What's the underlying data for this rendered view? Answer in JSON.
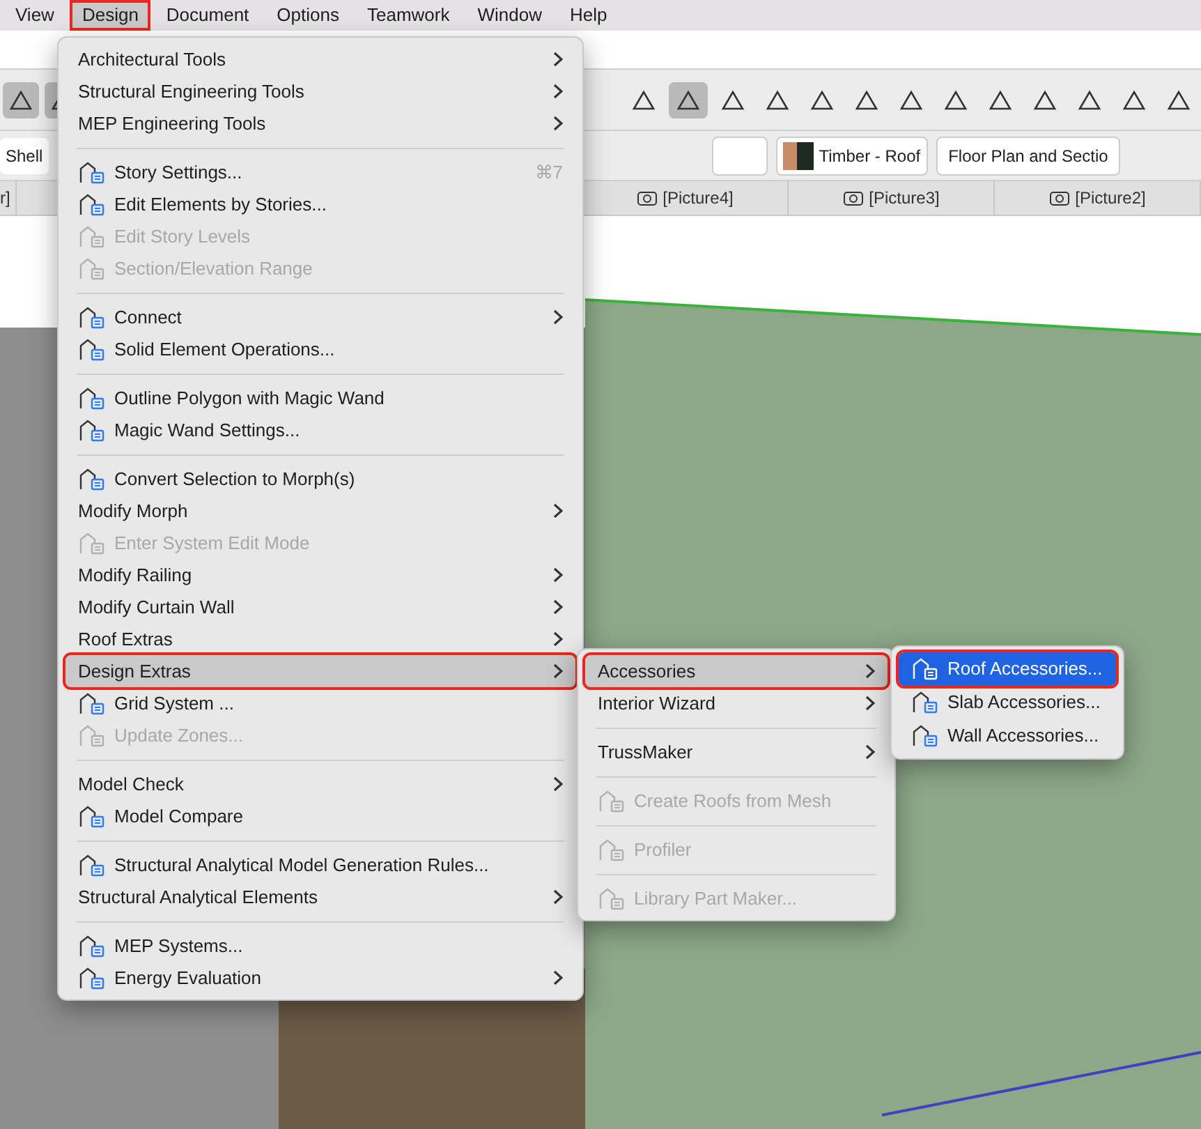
{
  "menu_bar": [
    {
      "label": "View",
      "selected": false,
      "annotated": false
    },
    {
      "label": "Design",
      "selected": true,
      "annotated": true
    },
    {
      "label": "Document",
      "selected": false,
      "annotated": false
    },
    {
      "label": "Options",
      "selected": false,
      "annotated": false
    },
    {
      "label": "Teamwork",
      "selected": false,
      "annotated": false
    },
    {
      "label": "Window",
      "selected": false,
      "annotated": false
    },
    {
      "label": "Help",
      "selected": false,
      "annotated": false
    }
  ],
  "toolbar": {
    "view_button": "Shell",
    "material": "Timber - Roof",
    "view_setting": "Floor Plan and Sectio"
  },
  "tabs": [
    {
      "label": "r]",
      "selected": false,
      "icon": false
    },
    {
      "label": "[Picture4]",
      "selected": false,
      "icon": true
    },
    {
      "label": "[Picture3]",
      "selected": false,
      "icon": true
    },
    {
      "label": "[Picture2]",
      "selected": false,
      "icon": true
    }
  ],
  "design_menu": [
    {
      "kind": "item",
      "label": "Architectural Tools",
      "icon": false,
      "submenu": true,
      "disabled": false,
      "selected": false,
      "annotated": false
    },
    {
      "kind": "item",
      "label": "Structural Engineering Tools",
      "icon": false,
      "submenu": true,
      "disabled": false,
      "selected": false,
      "annotated": false
    },
    {
      "kind": "item",
      "label": "MEP Engineering Tools",
      "icon": false,
      "submenu": true,
      "disabled": false,
      "selected": false,
      "annotated": false
    },
    {
      "kind": "separator"
    },
    {
      "kind": "item",
      "label": "Story Settings...",
      "icon": true,
      "submenu": false,
      "disabled": false,
      "selected": false,
      "annotated": false,
      "shortcut": "⌘7"
    },
    {
      "kind": "item",
      "label": "Edit Elements by Stories...",
      "icon": true,
      "submenu": false,
      "disabled": false,
      "selected": false,
      "annotated": false
    },
    {
      "kind": "item",
      "label": "Edit Story Levels",
      "icon": true,
      "submenu": false,
      "disabled": true,
      "selected": false,
      "annotated": false
    },
    {
      "kind": "item",
      "label": "Section/Elevation Range",
      "icon": true,
      "submenu": false,
      "disabled": true,
      "selected": false,
      "annotated": false
    },
    {
      "kind": "separator"
    },
    {
      "kind": "item",
      "label": "Connect",
      "icon": true,
      "submenu": true,
      "disabled": false,
      "selected": false,
      "annotated": false
    },
    {
      "kind": "item",
      "label": "Solid Element Operations...",
      "icon": true,
      "submenu": false,
      "disabled": false,
      "selected": false,
      "annotated": false
    },
    {
      "kind": "separator"
    },
    {
      "kind": "item",
      "label": "Outline Polygon with Magic Wand",
      "icon": true,
      "submenu": false,
      "disabled": false,
      "selected": false,
      "annotated": false
    },
    {
      "kind": "item",
      "label": "Magic Wand Settings...",
      "icon": true,
      "submenu": false,
      "disabled": false,
      "selected": false,
      "annotated": false
    },
    {
      "kind": "separator"
    },
    {
      "kind": "item",
      "label": "Convert Selection to Morph(s)",
      "icon": true,
      "submenu": false,
      "disabled": false,
      "selected": false,
      "annotated": false
    },
    {
      "kind": "item",
      "label": "Modify Morph",
      "icon": false,
      "submenu": true,
      "disabled": false,
      "selected": false,
      "annotated": false
    },
    {
      "kind": "item",
      "label": "Enter System Edit Mode",
      "icon": true,
      "submenu": false,
      "disabled": true,
      "selected": false,
      "annotated": false
    },
    {
      "kind": "item",
      "label": "Modify Railing",
      "icon": false,
      "submenu": true,
      "disabled": false,
      "selected": false,
      "annotated": false
    },
    {
      "kind": "item",
      "label": "Modify Curtain Wall",
      "icon": false,
      "submenu": true,
      "disabled": false,
      "selected": false,
      "annotated": false
    },
    {
      "kind": "item",
      "label": "Roof Extras",
      "icon": false,
      "submenu": true,
      "disabled": false,
      "selected": false,
      "annotated": false
    },
    {
      "kind": "item",
      "label": "Design Extras",
      "icon": false,
      "submenu": true,
      "disabled": false,
      "selected": true,
      "annotated": true
    },
    {
      "kind": "item",
      "label": "Grid System ...",
      "icon": true,
      "submenu": false,
      "disabled": false,
      "selected": false,
      "annotated": false
    },
    {
      "kind": "item",
      "label": "Update Zones...",
      "icon": true,
      "submenu": false,
      "disabled": true,
      "selected": false,
      "annotated": false
    },
    {
      "kind": "separator"
    },
    {
      "kind": "item",
      "label": "Model Check",
      "icon": false,
      "submenu": true,
      "disabled": false,
      "selected": false,
      "annotated": false
    },
    {
      "kind": "item",
      "label": "Model Compare",
      "icon": true,
      "submenu": false,
      "disabled": false,
      "selected": false,
      "annotated": false
    },
    {
      "kind": "separator"
    },
    {
      "kind": "item",
      "label": "Structural Analytical Model Generation Rules...",
      "icon": true,
      "submenu": false,
      "disabled": false,
      "selected": false,
      "annotated": false
    },
    {
      "kind": "item",
      "label": "Structural Analytical Elements",
      "icon": false,
      "submenu": true,
      "disabled": false,
      "selected": false,
      "annotated": false
    },
    {
      "kind": "separator"
    },
    {
      "kind": "item",
      "label": "MEP Systems...",
      "icon": true,
      "submenu": false,
      "disabled": false,
      "selected": false,
      "annotated": false
    },
    {
      "kind": "item",
      "label": "Energy Evaluation",
      "icon": true,
      "submenu": true,
      "disabled": false,
      "selected": false,
      "annotated": false
    }
  ],
  "design_extras_menu": [
    {
      "kind": "item",
      "label": "Accessories",
      "icon": false,
      "submenu": true,
      "disabled": false,
      "selected": true,
      "annotated": true
    },
    {
      "kind": "item",
      "label": "Interior Wizard",
      "icon": false,
      "submenu": true,
      "disabled": false,
      "selected": false,
      "annotated": false
    },
    {
      "kind": "separator"
    },
    {
      "kind": "item",
      "label": "TrussMaker",
      "icon": false,
      "submenu": true,
      "disabled": false,
      "selected": false,
      "annotated": false
    },
    {
      "kind": "separator"
    },
    {
      "kind": "item",
      "label": "Create Roofs from Mesh",
      "icon": true,
      "submenu": false,
      "disabled": true,
      "selected": false,
      "annotated": false
    },
    {
      "kind": "separator"
    },
    {
      "kind": "item",
      "label": "Profiler",
      "icon": true,
      "submenu": false,
      "disabled": true,
      "selected": false,
      "annotated": false
    },
    {
      "kind": "separator"
    },
    {
      "kind": "item",
      "label": "Library Part Maker...",
      "icon": true,
      "submenu": false,
      "disabled": true,
      "selected": false,
      "annotated": false
    }
  ],
  "accessories_menu": [
    {
      "kind": "item",
      "label": "Roof Accessories...",
      "icon": true,
      "disabled": false,
      "selected": true,
      "annotated": true
    },
    {
      "kind": "item",
      "label": "Slab Accessories...",
      "icon": true,
      "disabled": false,
      "selected": false,
      "annotated": false
    },
    {
      "kind": "item",
      "label": "Wall Accessories...",
      "icon": true,
      "disabled": false,
      "selected": false,
      "annotated": false
    }
  ]
}
